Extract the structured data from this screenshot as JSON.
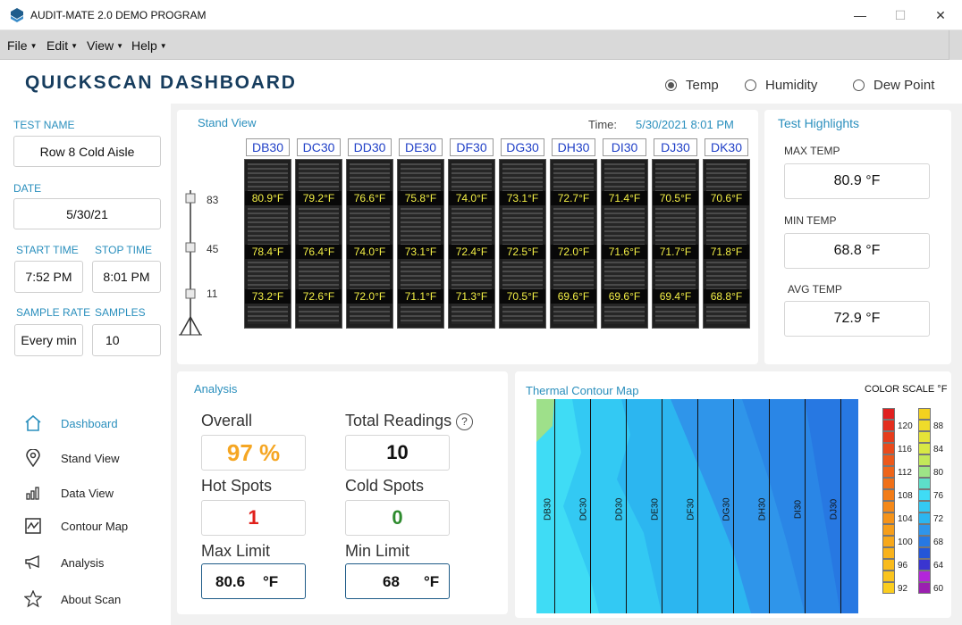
{
  "window": {
    "title": "AUDIT-MATE 2.0 DEMO PROGRAM",
    "minimize": "—",
    "maximize": "☐",
    "close": "✕"
  },
  "menu": {
    "items": [
      "File",
      "Edit",
      "View",
      "Help"
    ]
  },
  "header": {
    "title": "QUICKSCAN DASHBOARD",
    "radios": [
      {
        "label": "Temp",
        "selected": true
      },
      {
        "label": "Humidity",
        "selected": false
      },
      {
        "label": "Dew Point",
        "selected": false
      }
    ]
  },
  "sidebar": {
    "test_name_label": "TEST NAME",
    "test_name": "Row 8 Cold Aisle",
    "date_label": "DATE",
    "date": "5/30/21",
    "start_time_label": "START TIME",
    "start_time": "7:52 PM",
    "stop_time_label": "STOP TIME",
    "stop_time": "8:01 PM",
    "sample_rate_label": "SAMPLE RATE",
    "sample_rate": "Every min",
    "samples_label": "SAMPLES",
    "samples": "10",
    "nav": [
      "Dashboard",
      "Stand View",
      "Data View",
      "Contour Map",
      "Analysis",
      "About Scan"
    ]
  },
  "stand_view": {
    "title": "Stand View",
    "time_label": "Time:",
    "time_value": "5/30/2021 8:01 PM",
    "heights": [
      "83",
      "45",
      "11"
    ],
    "racks": [
      {
        "name": "DB30",
        "top": "80.9°F",
        "mid": "78.4°F",
        "bot": "73.2°F"
      },
      {
        "name": "DC30",
        "top": "79.2°F",
        "mid": "76.4°F",
        "bot": "72.6°F"
      },
      {
        "name": "DD30",
        "top": "76.6°F",
        "mid": "74.0°F",
        "bot": "72.0°F"
      },
      {
        "name": "DE30",
        "top": "75.8°F",
        "mid": "73.1°F",
        "bot": "71.1°F"
      },
      {
        "name": "DF30",
        "top": "74.0°F",
        "mid": "72.4°F",
        "bot": "71.3°F"
      },
      {
        "name": "DG30",
        "top": "73.1°F",
        "mid": "72.5°F",
        "bot": "70.5°F"
      },
      {
        "name": "DH30",
        "top": "72.7°F",
        "mid": "72.0°F",
        "bot": "69.6°F"
      },
      {
        "name": "DI30",
        "top": "71.4°F",
        "mid": "71.6°F",
        "bot": "69.6°F"
      },
      {
        "name": "DJ30",
        "top": "70.5°F",
        "mid": "71.7°F",
        "bot": "69.4°F"
      },
      {
        "name": "DK30",
        "top": "70.6°F",
        "mid": "71.8°F",
        "bot": "68.8°F"
      }
    ]
  },
  "highlights": {
    "title": "Test Highlights",
    "max_label": "MAX TEMP",
    "max": "80.9 °F",
    "min_label": "MIN TEMP",
    "min": "68.8 °F",
    "avg_label": "AVG TEMP",
    "avg": "72.9 °F"
  },
  "analysis": {
    "title": "Analysis",
    "overall_label": "Overall",
    "overall": "97 %",
    "total_label": "Total Readings",
    "total": "10",
    "hot_label": "Hot Spots",
    "hot": "1",
    "cold_label": "Cold Spots",
    "cold": "0",
    "max_limit_label": "Max Limit",
    "max_limit": "80.6",
    "max_unit": "°F",
    "min_limit_label": "Min Limit",
    "min_limit": "68",
    "min_unit": "°F",
    "colors": {
      "overall": "#f5a623",
      "hot": "#e0201b",
      "cold": "#2e8b2e"
    }
  },
  "contour": {
    "title": "Thermal  Contour Map",
    "columns": [
      "DB30",
      "DC30",
      "DD30",
      "DE30",
      "DF30",
      "DG30",
      "DH30",
      "DI30",
      "DJ30"
    ],
    "scale_title": "COLOR SCALE °F",
    "scale_left": [
      "120",
      "116",
      "112",
      "108",
      "104",
      "100",
      "96",
      "92"
    ],
    "scale_right": [
      "88",
      "84",
      "80",
      "76",
      "72",
      "68",
      "64",
      "60"
    ]
  }
}
